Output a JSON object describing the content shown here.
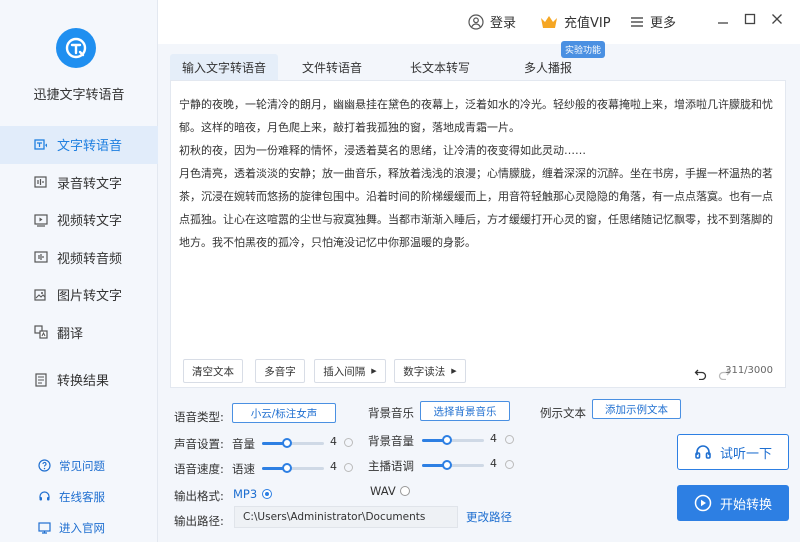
{
  "app": {
    "name": "迅捷文字转语音",
    "brand_color": "#1f8ff0",
    "accent_color": "#2d7fe3"
  },
  "topbar": {
    "login": "登录",
    "vip": "充值VIP",
    "more": "更多",
    "badge": "实验功能"
  },
  "sidebar": {
    "items": [
      {
        "label": "文字转语音",
        "icon": "text-to-speech-icon",
        "active": true
      },
      {
        "label": "录音转文字",
        "icon": "recording-icon"
      },
      {
        "label": "视频转文字",
        "icon": "video-text-icon"
      },
      {
        "label": "视频转音频",
        "icon": "video-audio-icon"
      },
      {
        "label": "图片转文字",
        "icon": "image-text-icon"
      },
      {
        "label": "翻译",
        "icon": "translate-icon"
      },
      {
        "label": "转换结果",
        "icon": "results-icon"
      }
    ],
    "links": [
      {
        "label": "常见问题",
        "icon": "question-icon"
      },
      {
        "label": "在线客服",
        "icon": "headset-icon"
      },
      {
        "label": "进入官网",
        "icon": "website-icon"
      }
    ]
  },
  "tabs": [
    {
      "label": "输入文字转语音",
      "active": true
    },
    {
      "label": "文件转语音"
    },
    {
      "label": "长文本转写"
    },
    {
      "label": "多人播报"
    }
  ],
  "editor": {
    "text": "宁静的夜晚，一轮清冷的朗月，幽幽悬挂在黛色的夜幕上，泛着如水的冷光。轻纱般的夜幕掩啦上来，增添啦几许朦胧和忧郁。这样的暗夜，月色爬上来，敲打着我孤独的窗，落地成青霜一片。\n初秋的夜，因为一份难释的情怀，浸透着莫名的思绪，让冷清的夜变得如此灵动……\n月色清亮，透着淡淡的安静；放一曲音乐，释放着浅浅的浪漫；心情朦胧，缠着深深的沉醉。坐在书房，手握一杯温热的茗茶，沉浸在婉转而悠扬的旋律包围中。沿着时间的阶梯缓缓而上，用音符轻触那心灵隐隐的角落，有一点点落寞。也有一点点孤独。让心在这喧嚣的尘世与寂寞独舞。当都市渐渐入睡后，方才缓缓打开心灵的窗，任思绪随记忆飘零，找不到落脚的地方。我不怕黑夜的孤冷，只怕淹没记忆中你那温暖的身影。",
    "buttons": {
      "clear": "清空文本",
      "polyphone": "多音字",
      "insert_pause": "插入间隔",
      "digit_read": "数字读法"
    },
    "counter": "311/3000"
  },
  "settings": {
    "voice_type_label": "语音类型:",
    "voice_type_value": "小云/标注女声",
    "bgm_label": "背景音乐",
    "bgm_button": "选择背景音乐",
    "example_label": "例示文本",
    "example_button": "添加示例文本",
    "sound_label": "声音设置:",
    "volume_label": "音量",
    "volume_value": 4,
    "volume_fraction": 0.4,
    "bg_volume_label": "背景音量",
    "bg_volume_value": 4,
    "bg_volume_fraction": 0.4,
    "speed_label": "语音速度:",
    "speed_sub_label": "语速",
    "speed_value": 4,
    "speed_fraction": 0.4,
    "pitch_label": "主播语调",
    "pitch_value": 4,
    "pitch_fraction": 0.4,
    "format_label": "输出格式:",
    "format_mp3": "MP3",
    "format_wav": "WAV",
    "format_selected": "MP3",
    "path_label": "输出路径:",
    "path_value": "C:\\Users\\Administrator\\Documents",
    "change_path": "更改路径"
  },
  "actions": {
    "listen": "试听一下",
    "convert": "开始转换"
  }
}
